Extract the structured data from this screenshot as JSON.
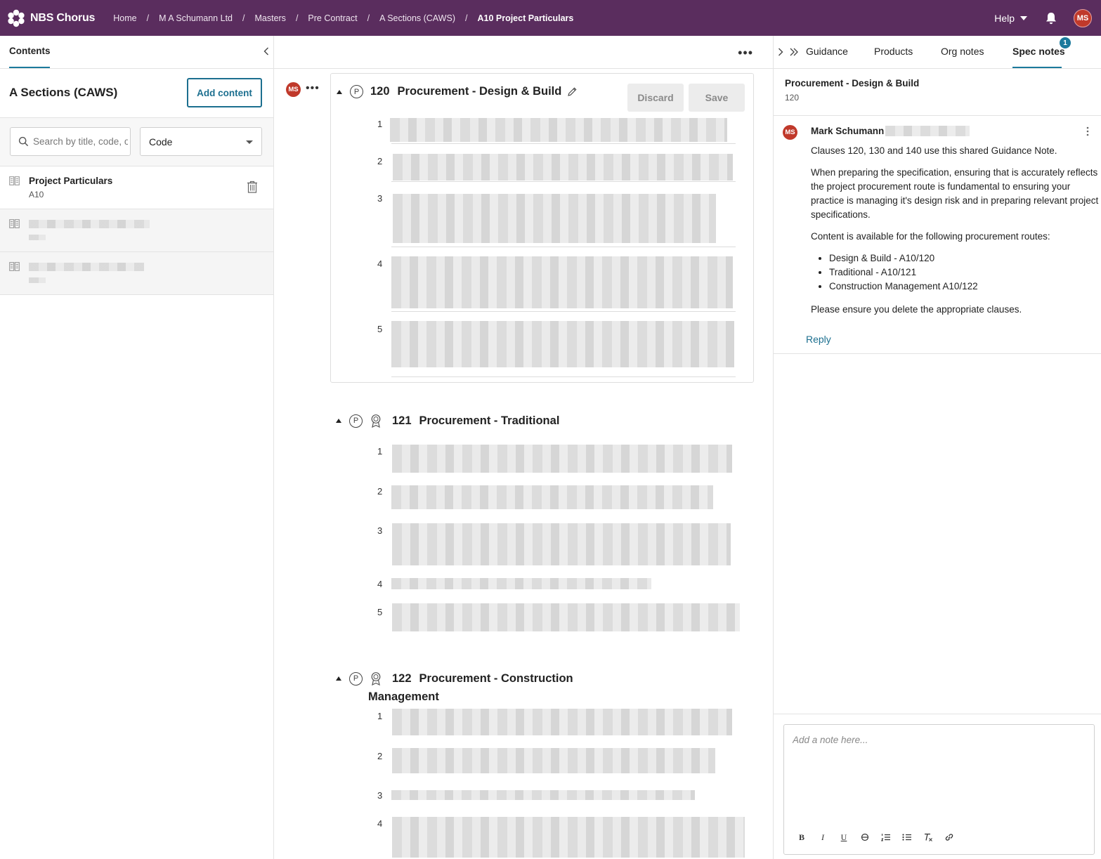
{
  "app": {
    "name": "NBS Chorus"
  },
  "breadcrumbs": [
    {
      "label": "Home"
    },
    {
      "label": "M A Schumann Ltd"
    },
    {
      "label": "Masters"
    },
    {
      "label": "Pre Contract"
    },
    {
      "label": "A Sections (CAWS)"
    },
    {
      "label": "A10 Project Particulars"
    }
  ],
  "topbar": {
    "help_label": "Help",
    "user_initials": "MS"
  },
  "left": {
    "tab_label": "Contents",
    "section_title": "A Sections (CAWS)",
    "add_content_label": "Add content",
    "search_placeholder": "Search by title, code, or keyword",
    "sort_value": "Code",
    "items": [
      {
        "title": "Project Particulars",
        "code": "A10"
      }
    ]
  },
  "clauses": [
    {
      "number": "120",
      "title": "Procurement - Design & Build",
      "paragraphs": [
        "1",
        "2",
        "3",
        "4",
        "5"
      ]
    },
    {
      "number": "121",
      "title": "Procurement - Traditional",
      "paragraphs": [
        "1",
        "2",
        "3",
        "4",
        "5"
      ]
    },
    {
      "number": "122",
      "title_line1": "Procurement - Construction",
      "title_line2": "Management",
      "paragraphs": [
        "1",
        "2",
        "3",
        "4"
      ]
    }
  ],
  "editor_actions": {
    "discard_label": "Discard",
    "save_label": "Save"
  },
  "editor_user_initials": "MS",
  "right": {
    "tabs": [
      {
        "label": "Guidance"
      },
      {
        "label": "Products"
      },
      {
        "label": "Org notes"
      },
      {
        "label": "Spec notes"
      }
    ],
    "spec_notes_badge": "1",
    "note_heading": {
      "title": "Procurement - Design & Build",
      "code": "120"
    },
    "note": {
      "author_initials": "MS",
      "author": "Mark Schumann",
      "p1": "Clauses 120, 130 and 140 use this shared Guidance Note.",
      "p2": "When preparing the specification, ensuring that is accurately reflects the project procurement route is fundamental to ensuring your practice is managing it's design risk and in preparing relevant project specifications.",
      "p3": "Content is available for the following procurement routes:",
      "bullets": [
        "Design & Build - A10/120",
        "Traditional - A10/121",
        "Construction Management A10/122"
      ],
      "p4": "Please ensure you delete the appropriate clauses.",
      "reply_label": "Reply"
    },
    "add_note_placeholder": "Add a note here...",
    "toolbar": {
      "bold": "B",
      "italic": "I",
      "underline": "U",
      "strike": "S",
      "ordered_list": "ordered-list-icon",
      "bullet_list": "bullet-list-icon",
      "clear_format": "clear-format-icon",
      "link": "link-icon"
    }
  },
  "colors": {
    "topbar": "#5a2d5e",
    "accent": "#1c6f8f",
    "avatar": "#c0392b"
  }
}
